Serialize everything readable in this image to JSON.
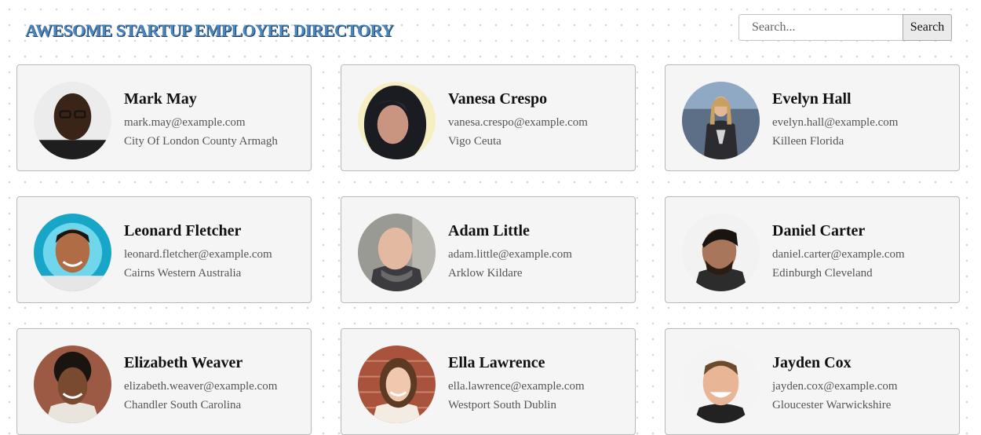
{
  "header": {
    "title": "AWESOME STARTUP EMPLOYEE DIRECTORY"
  },
  "search": {
    "placeholder": "Search...",
    "button_label": "Search"
  },
  "employees": [
    {
      "name": "Mark May",
      "email": "mark.may@example.com",
      "location": "City Of London County Armagh"
    },
    {
      "name": "Vanesa Crespo",
      "email": "vanesa.crespo@example.com",
      "location": "Vigo Ceuta"
    },
    {
      "name": "Evelyn Hall",
      "email": "evelyn.hall@example.com",
      "location": "Killeen Florida"
    },
    {
      "name": "Leonard Fletcher",
      "email": "leonard.fletcher@example.com",
      "location": "Cairns Western Australia"
    },
    {
      "name": "Adam Little",
      "email": "adam.little@example.com",
      "location": "Arklow Kildare"
    },
    {
      "name": "Daniel Carter",
      "email": "daniel.carter@example.com",
      "location": "Edinburgh Cleveland"
    },
    {
      "name": "Elizabeth Weaver",
      "email": "elizabeth.weaver@example.com",
      "location": "Chandler South Carolina"
    },
    {
      "name": "Ella Lawrence",
      "email": "ella.lawrence@example.com",
      "location": "Westport South Dublin"
    },
    {
      "name": "Jayden Cox",
      "email": "jayden.cox@example.com",
      "location": "Gloucester Warwickshire"
    }
  ]
}
